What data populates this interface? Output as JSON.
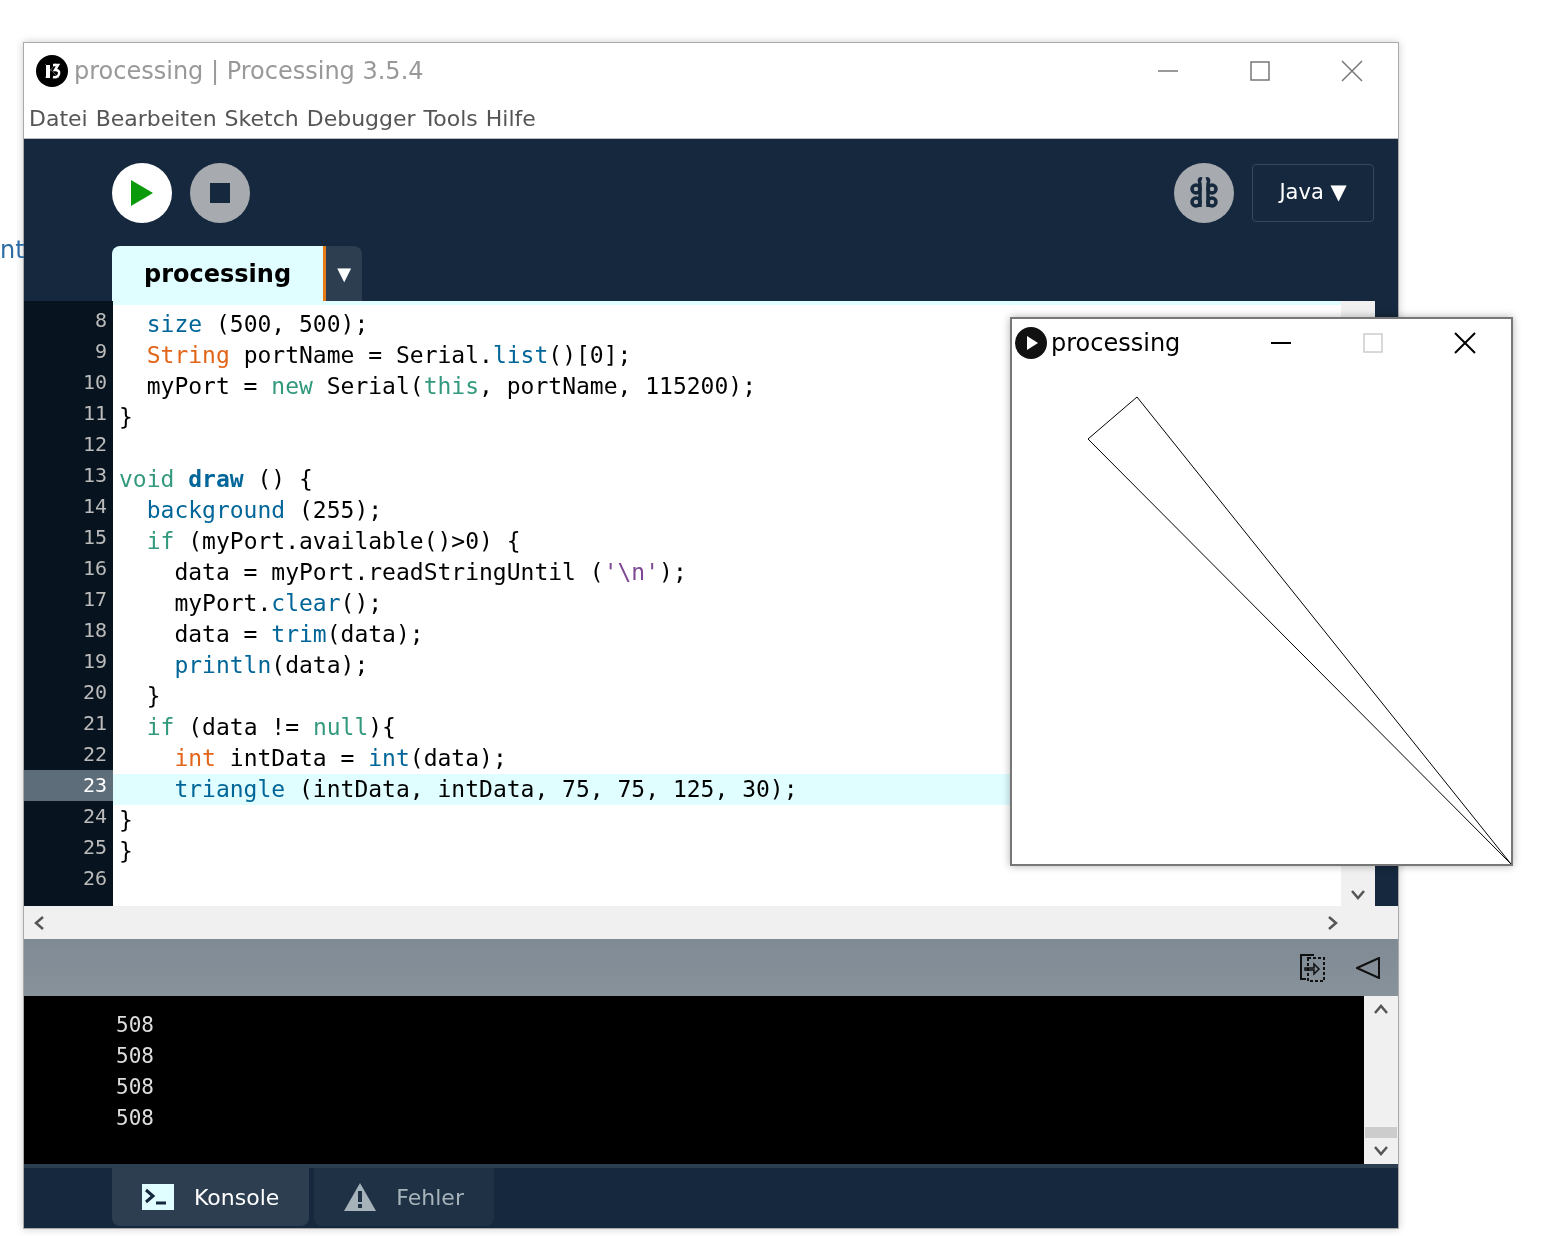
{
  "background_fragment": "nt",
  "window": {
    "title": "processing | Processing 3.5.4"
  },
  "menu": [
    "Datei",
    "Bearbeiten",
    "Sketch",
    "Debugger",
    "Tools",
    "Hilfe"
  ],
  "toolbar": {
    "mode": "Java",
    "mode_caret": "▼"
  },
  "tabs": [
    {
      "label": "processing",
      "selected": true
    }
  ],
  "tab_menu": "▼",
  "editor": {
    "lines": [
      {
        "number": "8",
        "current": false,
        "tokens": [
          {
            "kind": "function",
            "text": "  size"
          },
          {
            "kind": "plain",
            "text": " (500, 500);"
          }
        ]
      },
      {
        "number": "9",
        "current": false,
        "tokens": [
          {
            "kind": "type",
            "text": "  String"
          },
          {
            "kind": "plain",
            "text": " portName = Serial."
          },
          {
            "kind": "function",
            "text": "list"
          },
          {
            "kind": "plain",
            "text": "()[0];"
          }
        ]
      },
      {
        "number": "10",
        "current": false,
        "tokens": [
          {
            "kind": "plain",
            "text": "  myPort = "
          },
          {
            "kind": "keyword",
            "text": "new"
          },
          {
            "kind": "plain",
            "text": " Serial("
          },
          {
            "kind": "keyword",
            "text": "this"
          },
          {
            "kind": "plain",
            "text": ", portName, 115200);"
          }
        ]
      },
      {
        "number": "11",
        "current": false,
        "tokens": [
          {
            "kind": "plain",
            "text": "}"
          }
        ]
      },
      {
        "number": "12",
        "current": false
      },
      {
        "number": "13",
        "current": false,
        "tokens": [
          {
            "kind": "keyword",
            "text": "void "
          },
          {
            "kind": "definition",
            "text": "draw"
          },
          {
            "kind": "plain",
            "text": " () {"
          }
        ]
      },
      {
        "number": "14",
        "current": false,
        "tokens": [
          {
            "kind": "function",
            "text": "  background"
          },
          {
            "kind": "plain",
            "text": " (255);"
          }
        ]
      },
      {
        "number": "15",
        "current": false,
        "tokens": [
          {
            "kind": "keyword",
            "text": "  if"
          },
          {
            "kind": "plain",
            "text": " (myPort.available()>0) {"
          }
        ]
      },
      {
        "number": "16",
        "current": false,
        "tokens": [
          {
            "kind": "plain",
            "text": "    data = myPort.readStringUntil ("
          },
          {
            "kind": "string",
            "text": "'\\n'"
          },
          {
            "kind": "plain",
            "text": ");"
          }
        ]
      },
      {
        "number": "17",
        "current": false,
        "tokens": [
          {
            "kind": "plain",
            "text": "    myPort."
          },
          {
            "kind": "function",
            "text": "clear"
          },
          {
            "kind": "plain",
            "text": "();"
          }
        ]
      },
      {
        "number": "18",
        "current": false,
        "tokens": [
          {
            "kind": "plain",
            "text": "    data = "
          },
          {
            "kind": "function",
            "text": "trim"
          },
          {
            "kind": "plain",
            "text": "(data);"
          }
        ]
      },
      {
        "number": "19",
        "current": false,
        "tokens": [
          {
            "kind": "function",
            "text": "    println"
          },
          {
            "kind": "plain",
            "text": "(data);"
          }
        ]
      },
      {
        "number": "20",
        "current": false,
        "tokens": [
          {
            "kind": "plain",
            "text": "  }"
          }
        ]
      },
      {
        "number": "21",
        "current": false,
        "tokens": [
          {
            "kind": "keyword",
            "text": "  if"
          },
          {
            "kind": "plain",
            "text": " (data != "
          },
          {
            "kind": "keyword",
            "text": "null"
          },
          {
            "kind": "plain",
            "text": "){"
          }
        ]
      },
      {
        "number": "22",
        "current": false,
        "tokens": [
          {
            "kind": "type",
            "text": "    int"
          },
          {
            "kind": "plain",
            "text": " intData = "
          },
          {
            "kind": "function",
            "text": "int"
          },
          {
            "kind": "plain",
            "text": "(data);"
          }
        ]
      },
      {
        "number": "23",
        "current": true,
        "tokens": [
          {
            "kind": "function",
            "text": "    triangle"
          },
          {
            "kind": "plain",
            "text": " (intData, intData, 75, 75, 125, 30);"
          }
        ]
      },
      {
        "number": "24",
        "current": false,
        "tokens": [
          {
            "kind": "plain",
            "text": "}"
          }
        ]
      },
      {
        "number": "25",
        "current": false,
        "tokens": [
          {
            "kind": "plain",
            "text": "}"
          }
        ]
      },
      {
        "number": "26",
        "current": false
      }
    ]
  },
  "console": {
    "lines": [
      "508",
      "508",
      "508",
      "508"
    ]
  },
  "console_tabs": [
    {
      "label": "Konsole",
      "selected": true,
      "kind": "console"
    },
    {
      "label": "Fehler",
      "selected": false,
      "kind": "errors"
    }
  ],
  "sketch_window": {
    "title": "processing"
  }
}
